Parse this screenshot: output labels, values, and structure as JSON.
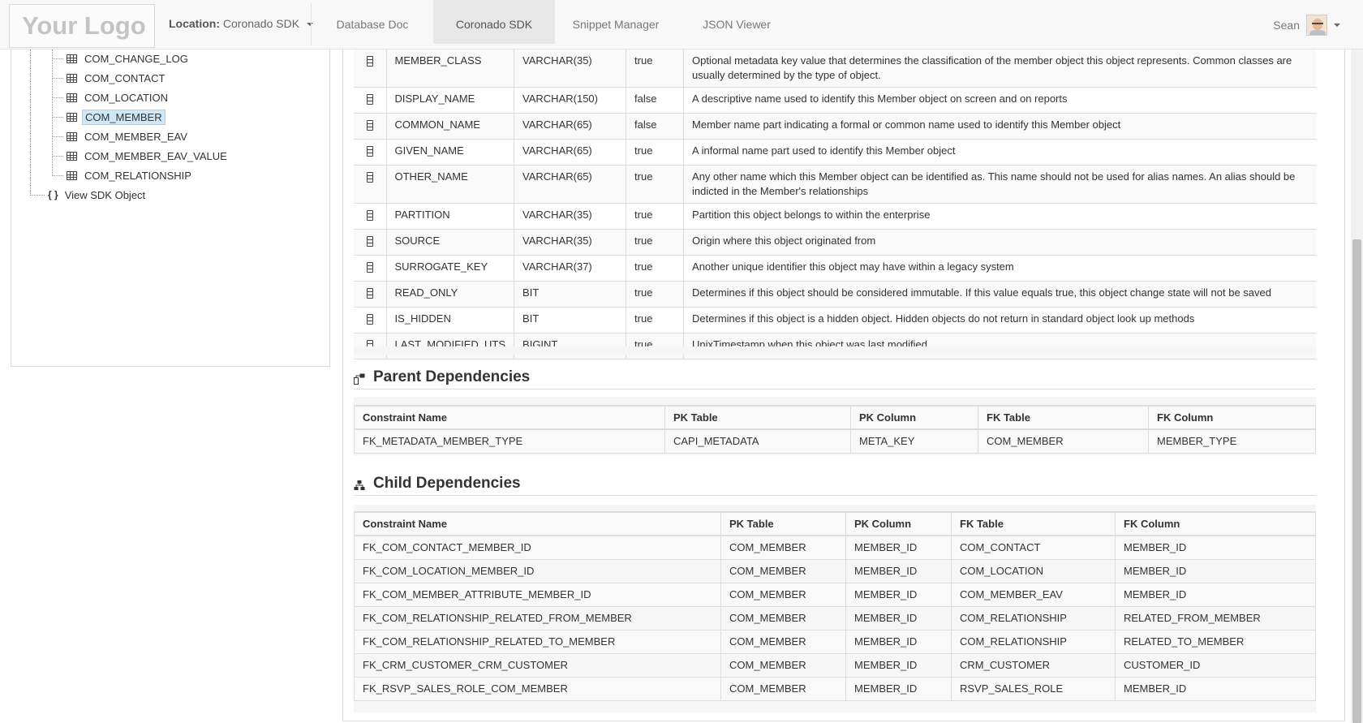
{
  "navbar": {
    "logo_text": "Your Logo",
    "location_label": "Location:",
    "location_value": "Coronado SDK",
    "tabs": [
      "Database Doc",
      "Coronado SDK",
      "Snippet Manager",
      "JSON Viewer"
    ],
    "active_tab": "Coronado SDK",
    "user_name": "Sean"
  },
  "tree": {
    "items": [
      "COM_CHANGE_LOG",
      "COM_CONTACT",
      "COM_LOCATION",
      "COM_MEMBER",
      "COM_MEMBER_EAV",
      "COM_MEMBER_EAV_VALUE",
      "COM_RELATIONSHIP"
    ],
    "selected": "COM_MEMBER",
    "view_sdk_label": "View SDK Object",
    "view_sdk_icon": "{ }"
  },
  "columns": {
    "rows": [
      {
        "name": "MEMBER_CLASS",
        "type": "VARCHAR(35)",
        "nullable": "true",
        "description": "Optional metadata key value that determines the classification of the member object this object represents. Common classes are usually determined by the type of object."
      },
      {
        "name": "DISPLAY_NAME",
        "type": "VARCHAR(150)",
        "nullable": "false",
        "description": "A descriptive name used to identify this Member object on screen and on reports"
      },
      {
        "name": "COMMON_NAME",
        "type": "VARCHAR(65)",
        "nullable": "false",
        "description": "Member name part indicating a formal or common name used to identify this Member object"
      },
      {
        "name": "GIVEN_NAME",
        "type": "VARCHAR(65)",
        "nullable": "true",
        "description": "A informal name part used to identify this Member object"
      },
      {
        "name": "OTHER_NAME",
        "type": "VARCHAR(65)",
        "nullable": "true",
        "description": "Any other name which this Member object can be identified as. This name should not be used for alias names. An alias should be indicted in the Member's relationships"
      },
      {
        "name": "PARTITION",
        "type": "VARCHAR(35)",
        "nullable": "true",
        "description": "Partition this object belongs to within the enterprise"
      },
      {
        "name": "SOURCE",
        "type": "VARCHAR(35)",
        "nullable": "true",
        "description": "Origin where this object originated from"
      },
      {
        "name": "SURROGATE_KEY",
        "type": "VARCHAR(37)",
        "nullable": "true",
        "description": "Another unique identifier this object may have within a legacy system"
      },
      {
        "name": "READ_ONLY",
        "type": "BIT",
        "nullable": "true",
        "description": "Determines if this object should be considered immutable. If this value equals true, this object change state will not be saved"
      },
      {
        "name": "IS_HIDDEN",
        "type": "BIT",
        "nullable": "true",
        "description": "Determines if this object is a hidden object. Hidden objects do not return in standard object look up methods"
      },
      {
        "name": "LAST_MODIFIED_UTS",
        "type": "BIGINT",
        "nullable": "true",
        "description": "UnixTimestamp when this object was last modified."
      }
    ]
  },
  "parent_deps": {
    "title": "Parent Dependencies",
    "headers": [
      "Constraint Name",
      "PK Table",
      "PK Column",
      "FK Table",
      "FK Column"
    ],
    "rows": [
      [
        "FK_METADATA_MEMBER_TYPE",
        "CAPI_METADATA",
        "META_KEY",
        "COM_MEMBER",
        "MEMBER_TYPE"
      ]
    ]
  },
  "child_deps": {
    "title": "Child Dependencies",
    "headers": [
      "Constraint Name",
      "PK Table",
      "PK Column",
      "FK Table",
      "FK Column"
    ],
    "rows": [
      [
        "FK_COM_CONTACT_MEMBER_ID",
        "COM_MEMBER",
        "MEMBER_ID",
        "COM_CONTACT",
        "MEMBER_ID"
      ],
      [
        "FK_COM_LOCATION_MEMBER_ID",
        "COM_MEMBER",
        "MEMBER_ID",
        "COM_LOCATION",
        "MEMBER_ID"
      ],
      [
        "FK_COM_MEMBER_ATTRIBUTE_MEMBER_ID",
        "COM_MEMBER",
        "MEMBER_ID",
        "COM_MEMBER_EAV",
        "MEMBER_ID"
      ],
      [
        "FK_COM_RELATIONSHIP_RELATED_FROM_MEMBER",
        "COM_MEMBER",
        "MEMBER_ID",
        "COM_RELATIONSHIP",
        "RELATED_FROM_MEMBER"
      ],
      [
        "FK_COM_RELATIONSHIP_RELATED_TO_MEMBER",
        "COM_MEMBER",
        "MEMBER_ID",
        "COM_RELATIONSHIP",
        "RELATED_TO_MEMBER"
      ],
      [
        "FK_CRM_CUSTOMER_CRM_CUSTOMER",
        "COM_MEMBER",
        "MEMBER_ID",
        "CRM_CUSTOMER",
        "CUSTOMER_ID"
      ],
      [
        "FK_RSVP_SALES_ROLE_COM_MEMBER",
        "COM_MEMBER",
        "MEMBER_ID",
        "RSVP_SALES_ROLE",
        "MEMBER_ID"
      ]
    ]
  }
}
